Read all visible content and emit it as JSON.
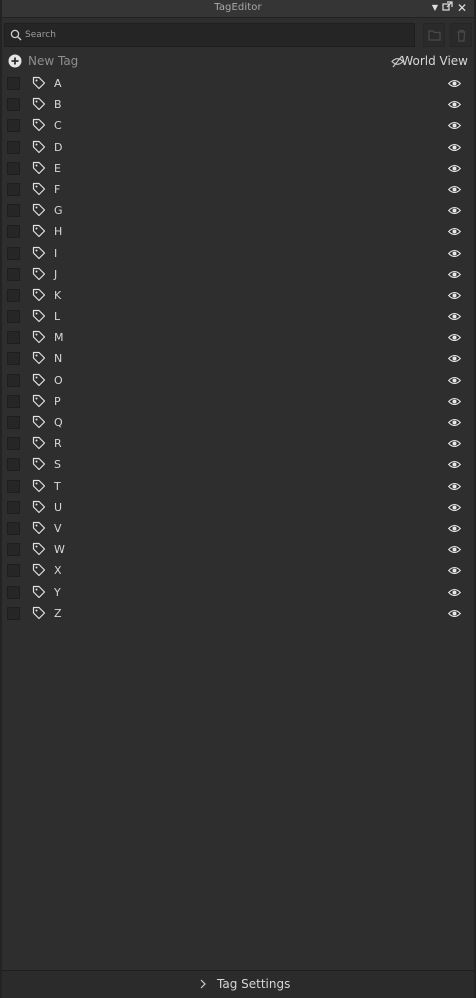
{
  "window": {
    "title": "TagEditor"
  },
  "toolbar": {
    "search_placeholder": "Search",
    "search_value": ""
  },
  "header": {
    "new_tag_label": "New Tag",
    "world_view_label": "World View"
  },
  "tags": [
    {
      "name": "A"
    },
    {
      "name": "B"
    },
    {
      "name": "C"
    },
    {
      "name": "D"
    },
    {
      "name": "E"
    },
    {
      "name": "F"
    },
    {
      "name": "G"
    },
    {
      "name": "H"
    },
    {
      "name": "I"
    },
    {
      "name": "J"
    },
    {
      "name": "K"
    },
    {
      "name": "L"
    },
    {
      "name": "M"
    },
    {
      "name": "N"
    },
    {
      "name": "O"
    },
    {
      "name": "P"
    },
    {
      "name": "Q"
    },
    {
      "name": "R"
    },
    {
      "name": "S"
    },
    {
      "name": "T"
    },
    {
      "name": "U"
    },
    {
      "name": "V"
    },
    {
      "name": "W"
    },
    {
      "name": "X"
    },
    {
      "name": "Y"
    },
    {
      "name": "Z"
    }
  ],
  "footer": {
    "settings_label": "Tag Settings"
  },
  "colors": {
    "background": "#2e2e2e",
    "titlebar": "#353535",
    "input_bg": "#252525",
    "text": "#d8d8d8",
    "muted_text": "#8f8f8f"
  }
}
